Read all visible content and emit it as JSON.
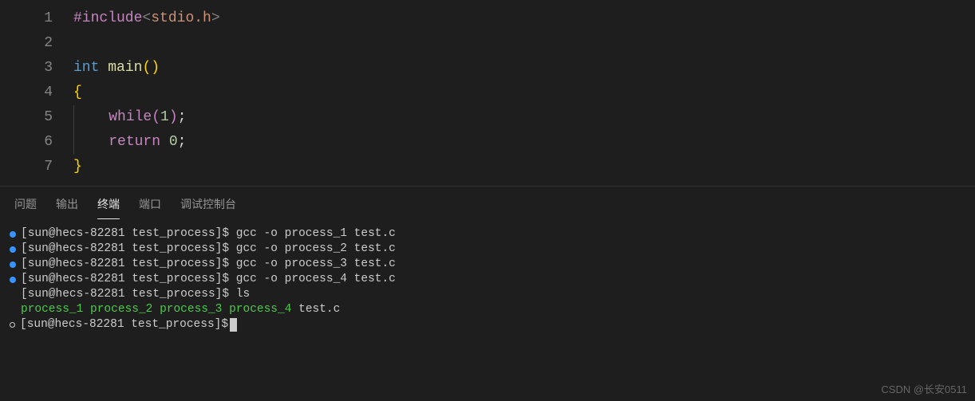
{
  "editor": {
    "lines": [
      {
        "num": "1",
        "tokens": [
          {
            "cls": "keyword",
            "t": "#include"
          },
          {
            "cls": "angle",
            "t": "<"
          },
          {
            "cls": "string",
            "t": "stdio.h"
          },
          {
            "cls": "angle",
            "t": ">"
          }
        ]
      },
      {
        "num": "2",
        "tokens": []
      },
      {
        "num": "3",
        "tokens": [
          {
            "cls": "type",
            "t": "int"
          },
          {
            "cls": "punct",
            "t": " "
          },
          {
            "cls": "func",
            "t": "main"
          },
          {
            "cls": "brace-yellow",
            "t": "()"
          }
        ]
      },
      {
        "num": "4",
        "tokens": [
          {
            "cls": "brace-yellow",
            "t": "{"
          }
        ]
      },
      {
        "num": "5",
        "tokens": [
          {
            "cls": "guide",
            "t": ""
          },
          {
            "cls": "punct",
            "t": "    "
          },
          {
            "cls": "keyword",
            "t": "while"
          },
          {
            "cls": "paren-purple",
            "t": "("
          },
          {
            "cls": "number",
            "t": "1"
          },
          {
            "cls": "paren-purple",
            "t": ")"
          },
          {
            "cls": "punct",
            "t": ";"
          }
        ]
      },
      {
        "num": "6",
        "tokens": [
          {
            "cls": "guide",
            "t": ""
          },
          {
            "cls": "punct",
            "t": "    "
          },
          {
            "cls": "keyword",
            "t": "return"
          },
          {
            "cls": "punct",
            "t": " "
          },
          {
            "cls": "number",
            "t": "0"
          },
          {
            "cls": "punct",
            "t": ";"
          }
        ]
      },
      {
        "num": "7",
        "tokens": [
          {
            "cls": "brace-yellow",
            "t": "}"
          }
        ]
      }
    ]
  },
  "panel": {
    "tabs": [
      "问题",
      "输出",
      "终端",
      "端口",
      "调试控制台"
    ],
    "active": 2,
    "terminal": {
      "prompt": "[sun@hecs-82281 test_process]$",
      "lines": [
        {
          "bullet": "solid",
          "cmd": "gcc -o process_1 test.c"
        },
        {
          "bullet": "solid",
          "cmd": "gcc -o process_2 test.c"
        },
        {
          "bullet": "solid",
          "cmd": "gcc -o process_3 test.c"
        },
        {
          "bullet": "solid",
          "cmd": "gcc -o process_4 test.c"
        },
        {
          "bullet": "none",
          "cmd": "ls"
        }
      ],
      "ls_output": {
        "executables": [
          "process_1",
          "process_2",
          "process_3",
          "process_4"
        ],
        "files": [
          "test.c"
        ]
      },
      "current": {
        "bullet": "hollow",
        "cmd": ""
      }
    }
  },
  "watermark": "CSDN @长安0511"
}
